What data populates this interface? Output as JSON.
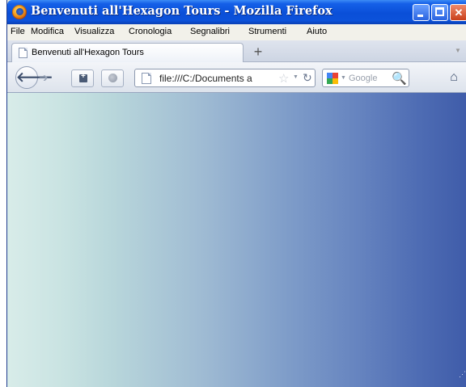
{
  "window": {
    "title": "Benvenuti all'Hexagon Tours - Mozilla Firefox"
  },
  "menubar": {
    "items": [
      "File",
      "Modifica",
      "Visualizza",
      "Cronologia",
      "Segnalibri",
      "Strumenti",
      "Aiuto"
    ]
  },
  "tabs": {
    "active_label": "Benvenuti all'Hexagon Tours",
    "new_tab_label": "+"
  },
  "navbar": {
    "url": "file:///C:/Documents a",
    "search_placeholder": "Google"
  },
  "icons": {
    "app": "firefox-icon",
    "back": "back-arrow-icon",
    "forward": "forward-arrow-icon",
    "bookmark": "star-icon",
    "reload": "reload-icon",
    "search_engine": "google-icon",
    "search": "magnifier-icon",
    "home": "home-icon"
  },
  "colors": {
    "titlebar": "#0a4fd8",
    "content_gradient_start": "#d8ece9",
    "content_gradient_end": "#3d5aa8"
  }
}
